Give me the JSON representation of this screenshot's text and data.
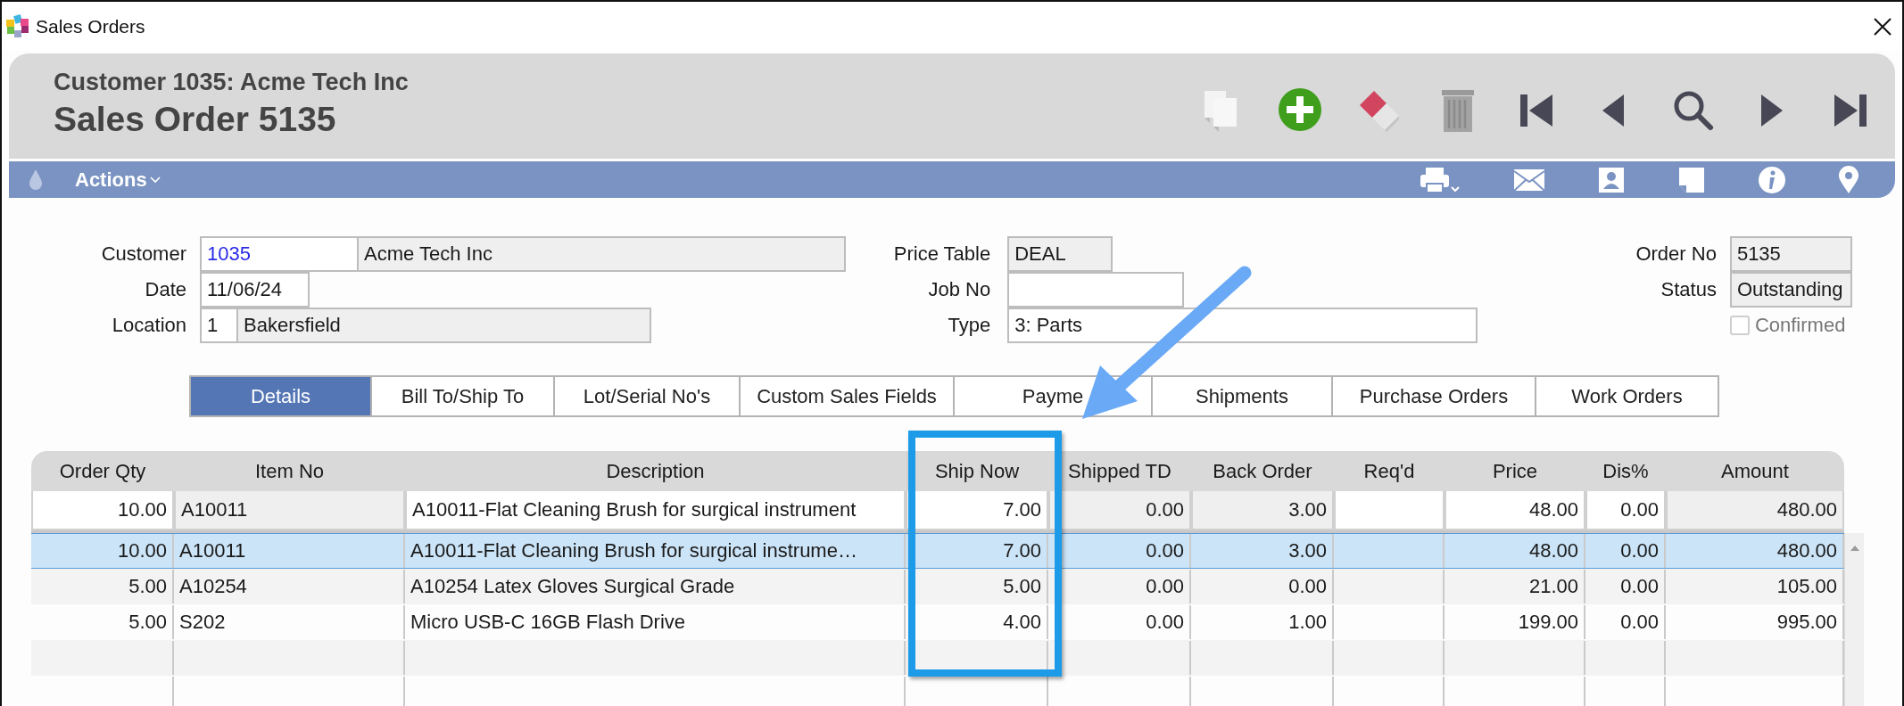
{
  "window": {
    "title": "Sales Orders"
  },
  "header": {
    "subtitle": "Customer 1035: Acme Tech Inc",
    "title": "Sales Order 5135"
  },
  "action_bar": {
    "menu": "Actions"
  },
  "form": {
    "groups": [
      {
        "fields": [
          {
            "kind": "field",
            "label": "Customer",
            "boxes": [
              {
                "value": "1035",
                "readonly": false,
                "link": true
              },
              {
                "value": "Acme Tech Inc",
                "readonly": true,
                "link": false
              }
            ]
          },
          {
            "kind": "field",
            "label": "Date",
            "boxes": [
              {
                "value": "11/06/24",
                "readonly": false,
                "link": false
              }
            ]
          },
          {
            "kind": "field",
            "label": "Location",
            "boxes": [
              {
                "value": "1",
                "readonly": false,
                "link": false
              },
              {
                "value": "Bakersfield",
                "readonly": true,
                "link": false
              }
            ]
          }
        ]
      },
      {
        "fields": [
          {
            "kind": "field",
            "label": "Price Table",
            "boxes": [
              {
                "value": "DEAL",
                "readonly": true,
                "link": false
              }
            ]
          },
          {
            "kind": "field",
            "label": "Job No",
            "boxes": [
              {
                "readonly": false
              }
            ]
          },
          {
            "kind": "field",
            "label": "Type",
            "boxes": [
              {
                "value": "3: Parts",
                "readonly": false,
                "link": false
              }
            ]
          }
        ]
      },
      {
        "fields": [
          {
            "kind": "field",
            "label": "Order No",
            "boxes": [
              {
                "value": "5135",
                "readonly": true,
                "link": false
              }
            ]
          },
          {
            "kind": "field",
            "label": "Status",
            "boxes": [
              {
                "value": "Outstanding",
                "readonly": true,
                "link": false
              }
            ]
          },
          {
            "kind": "checkbox",
            "label": "Confirmed",
            "checked": false,
            "disabled": true
          }
        ]
      }
    ]
  },
  "tabs": [
    {
      "label": "Details",
      "selected": true
    },
    {
      "label": "Bill To/Ship To",
      "selected": false
    },
    {
      "label": "Lot/Serial No's",
      "selected": false
    },
    {
      "label": "Custom Sales Fields",
      "selected": false
    },
    {
      "label": "Payme",
      "selected": false
    },
    {
      "label": "Shipments",
      "selected": false
    },
    {
      "label": "Purchase Orders",
      "selected": false
    },
    {
      "label": "Work Orders",
      "selected": false
    }
  ],
  "table": {
    "columns": [
      {
        "label": "Order Qty",
        "kind": "number"
      },
      {
        "label": "Item No",
        "kind": "text"
      },
      {
        "label": "Description",
        "kind": "text"
      },
      {
        "label": "Ship Now",
        "kind": "number"
      },
      {
        "label": "Shipped TD",
        "kind": "number"
      },
      {
        "label": "Back Order",
        "kind": "number"
      },
      {
        "label": "Req'd",
        "kind": "text"
      },
      {
        "label": "Price",
        "kind": "number"
      },
      {
        "label": "Dis%",
        "kind": "number"
      },
      {
        "label": "Amount",
        "kind": "number"
      }
    ],
    "entry_row": [
      {
        "value": "10.00",
        "readonly": false
      },
      {
        "value": "A10011",
        "readonly": true
      },
      {
        "value": "A10011-Flat Cleaning Brush for surgical instrument",
        "readonly": false
      },
      {
        "value": "7.00",
        "readonly": false
      },
      {
        "value": "0.00",
        "readonly": true
      },
      {
        "value": "3.00",
        "readonly": true
      },
      {
        "readonly": false
      },
      {
        "value": "48.00",
        "readonly": false
      },
      {
        "value": "0.00",
        "readonly": false
      },
      {
        "value": "480.00",
        "readonly": true
      }
    ],
    "rows": [
      {
        "selected": true,
        "cells": [
          "10.00",
          "A10011",
          "A10011-Flat Cleaning Brush for surgical instrume…",
          "7.00",
          "0.00",
          "3.00",
          "",
          "48.00",
          "0.00",
          "480.00"
        ]
      },
      {
        "selected": false,
        "cells": [
          "5.00",
          "A10254",
          "A10254 Latex Gloves Surgical Grade",
          "5.00",
          "0.00",
          "0.00",
          "",
          "21.00",
          "0.00",
          "105.00"
        ]
      },
      {
        "selected": false,
        "cells": [
          "5.00",
          "S202",
          "Micro USB-C 16GB Flash Drive",
          "4.00",
          "0.00",
          "1.00",
          "",
          "199.00",
          "0.00",
          "995.00"
        ]
      }
    ]
  }
}
